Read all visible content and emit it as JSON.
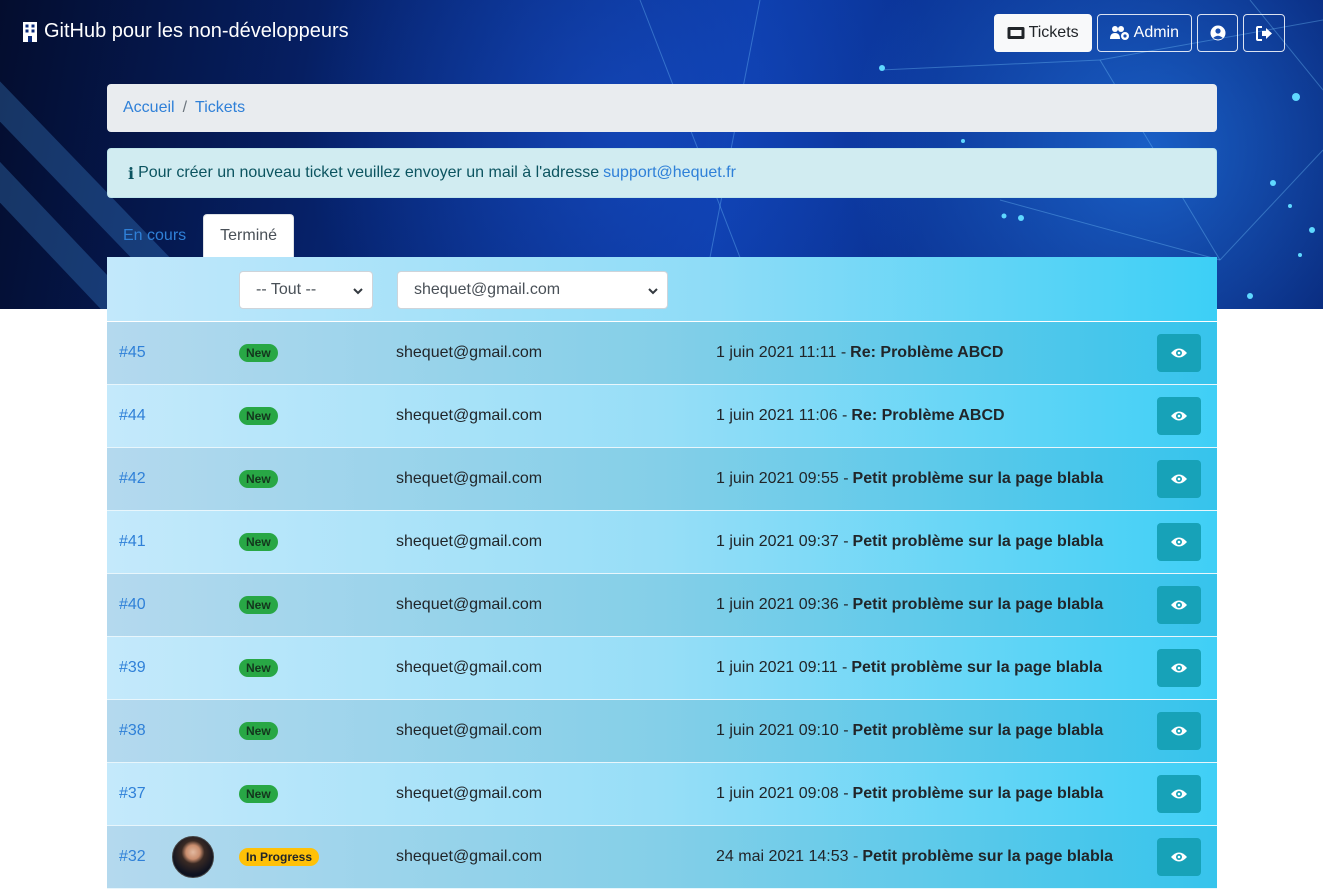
{
  "navbar": {
    "brand": "GitHub pour les non-développeurs",
    "buttons": [
      {
        "label": "Tickets",
        "icon": "ticket-icon",
        "active": true
      },
      {
        "label": "Admin",
        "icon": "users-cog-icon",
        "active": false
      },
      {
        "label": "",
        "icon": "user-circle-icon",
        "active": false
      },
      {
        "label": "",
        "icon": "sign-out-icon",
        "active": false
      }
    ]
  },
  "breadcrumb": {
    "home": "Accueil",
    "separator": "/",
    "current": "Tickets"
  },
  "alert": {
    "icon": "i",
    "text": "Pour créer un nouveau ticket veuillez envoyer un mail à l'adresse",
    "email": "support@hequet.fr"
  },
  "tabs": [
    {
      "label": "En cours",
      "active": false
    },
    {
      "label": "Terminé",
      "active": true
    }
  ],
  "filters": {
    "status": "-- Tout --",
    "user": "shequet@gmail.com"
  },
  "tickets": [
    {
      "id": "#45",
      "status": "New",
      "email": "shequet@gmail.com",
      "date": "1 juin 2021 11:11 -",
      "title": "Re: Problème ABCD",
      "avatar": false
    },
    {
      "id": "#44",
      "status": "New",
      "email": "shequet@gmail.com",
      "date": "1 juin 2021 11:06 -",
      "title": "Re: Problème ABCD",
      "avatar": false
    },
    {
      "id": "#42",
      "status": "New",
      "email": "shequet@gmail.com",
      "date": "1 juin 2021 09:55 -",
      "title": "Petit problème sur la page blabla",
      "avatar": false
    },
    {
      "id": "#41",
      "status": "New",
      "email": "shequet@gmail.com",
      "date": "1 juin 2021 09:37 -",
      "title": "Petit problème sur la page blabla",
      "avatar": false
    },
    {
      "id": "#40",
      "status": "New",
      "email": "shequet@gmail.com",
      "date": "1 juin 2021 09:36 -",
      "title": "Petit problème sur la page blabla",
      "avatar": false
    },
    {
      "id": "#39",
      "status": "New",
      "email": "shequet@gmail.com",
      "date": "1 juin 2021 09:11 -",
      "title": "Petit problème sur la page blabla",
      "avatar": false
    },
    {
      "id": "#38",
      "status": "New",
      "email": "shequet@gmail.com",
      "date": "1 juin 2021 09:10 -",
      "title": "Petit problème sur la page blabla",
      "avatar": false
    },
    {
      "id": "#37",
      "status": "New",
      "email": "shequet@gmail.com",
      "date": "1 juin 2021 09:08 -",
      "title": "Petit problème sur la page blabla",
      "avatar": false
    },
    {
      "id": "#32",
      "status": "In Progress",
      "email": "shequet@gmail.com",
      "date": "24 mai 2021 14:53 -",
      "title": "Petit problème sur la page blabla",
      "avatar": true
    }
  ],
  "colors": {
    "link": "#2f80d8",
    "badge_new": "#28a745",
    "badge_progress": "#ffc107",
    "view_button": "#17a2b8"
  }
}
